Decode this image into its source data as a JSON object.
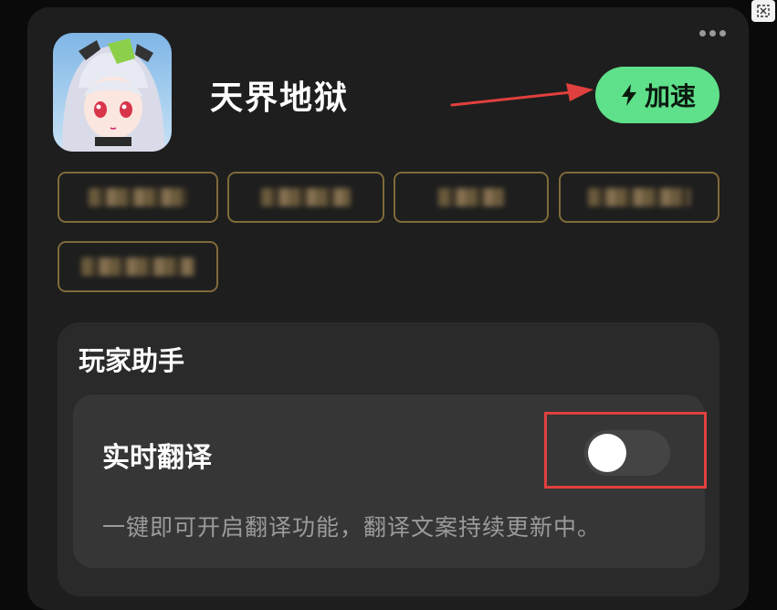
{
  "game": {
    "title": "天界地狱",
    "boost_label": "加速"
  },
  "tags": [
    "",
    "",
    "",
    "",
    ""
  ],
  "assistant": {
    "section_title": "玩家助手",
    "feature_name": "实时翻译",
    "feature_description": "一键即可开启翻译功能，翻译文案持续更新中。",
    "toggle_on": false
  },
  "colors": {
    "accent_green": "#5fe08a",
    "annotation_red": "#e0403e",
    "tag_border": "#7f6a3a"
  },
  "icons": [
    "close-corner-icon",
    "more-dots-icon",
    "lightning-icon",
    "arrow-annotation-icon"
  ]
}
